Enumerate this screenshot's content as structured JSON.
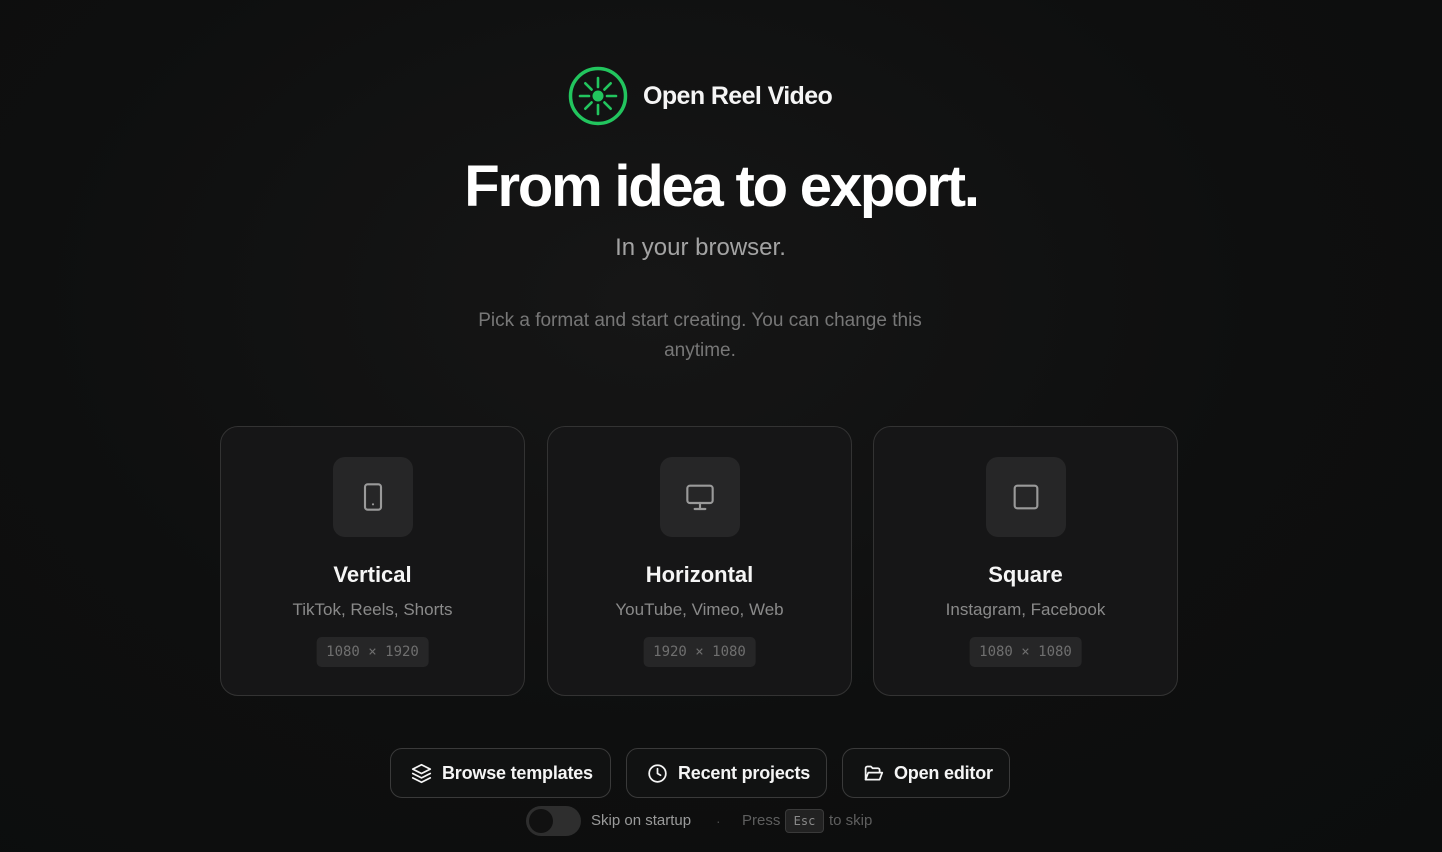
{
  "brand": {
    "name": "Open Reel Video",
    "logo_icon": "reel-sun-icon",
    "accent_color": "#22c55e"
  },
  "hero": {
    "title": "From idea to export.",
    "subtitle": "In your browser.",
    "intro": "Pick a format and start creating. You can change this anytime."
  },
  "formats": [
    {
      "title": "Vertical",
      "subtitle": "TikTok, Reels, Shorts",
      "dimensions": "1080 × 1920",
      "icon": "smartphone-icon"
    },
    {
      "title": "Horizontal",
      "subtitle": "YouTube, Vimeo, Web",
      "dimensions": "1920 × 1080",
      "icon": "monitor-icon"
    },
    {
      "title": "Square",
      "subtitle": "Instagram, Facebook",
      "dimensions": "1080 × 1080",
      "icon": "square-icon"
    }
  ],
  "actions": [
    {
      "label": "Browse templates",
      "icon": "layers-icon"
    },
    {
      "label": "Recent projects",
      "icon": "clock-icon"
    },
    {
      "label": "Open editor",
      "icon": "folder-open-icon"
    }
  ],
  "footer": {
    "skip_label": "Skip on startup",
    "skip_enabled": false,
    "separator": "·",
    "press_text": "Press",
    "key": "Esc",
    "skip_text": "to skip"
  }
}
